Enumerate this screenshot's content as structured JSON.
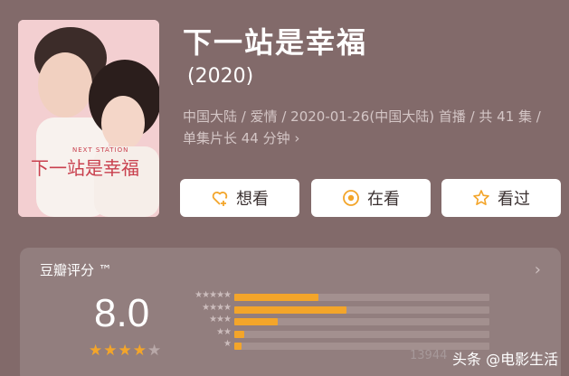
{
  "movie": {
    "title": "下一站是幸福",
    "year": "(2020)",
    "meta": "中国大陆 / 爱情 / 2020-01-26(中国大陆) 首播 / 共 41 集 / 单集片长 44 分钟 ›",
    "poster_text": "下一站是幸福",
    "poster_subtext": "NEXT STATION"
  },
  "actions": {
    "want_label": "想看",
    "watching_label": "在看",
    "seen_label": "看过",
    "want_icon": "heart-plus-icon",
    "watching_icon": "target-circle-icon",
    "seen_icon": "star-outline-icon",
    "accent": "#f3a52a"
  },
  "rating": {
    "label": "豆瓣评分 ™",
    "score": "8.0",
    "stars_value": 4,
    "stars_max": 5,
    "count": "13944",
    "distribution": [
      {
        "stars": 5,
        "fraction": 0.33
      },
      {
        "stars": 4,
        "fraction": 0.44
      },
      {
        "stars": 3,
        "fraction": 0.17
      },
      {
        "stars": 2,
        "fraction": 0.04
      },
      {
        "stars": 1,
        "fraction": 0.03
      }
    ],
    "bar_color": "#f3a52a"
  },
  "watermark": "头条 @电影生活"
}
